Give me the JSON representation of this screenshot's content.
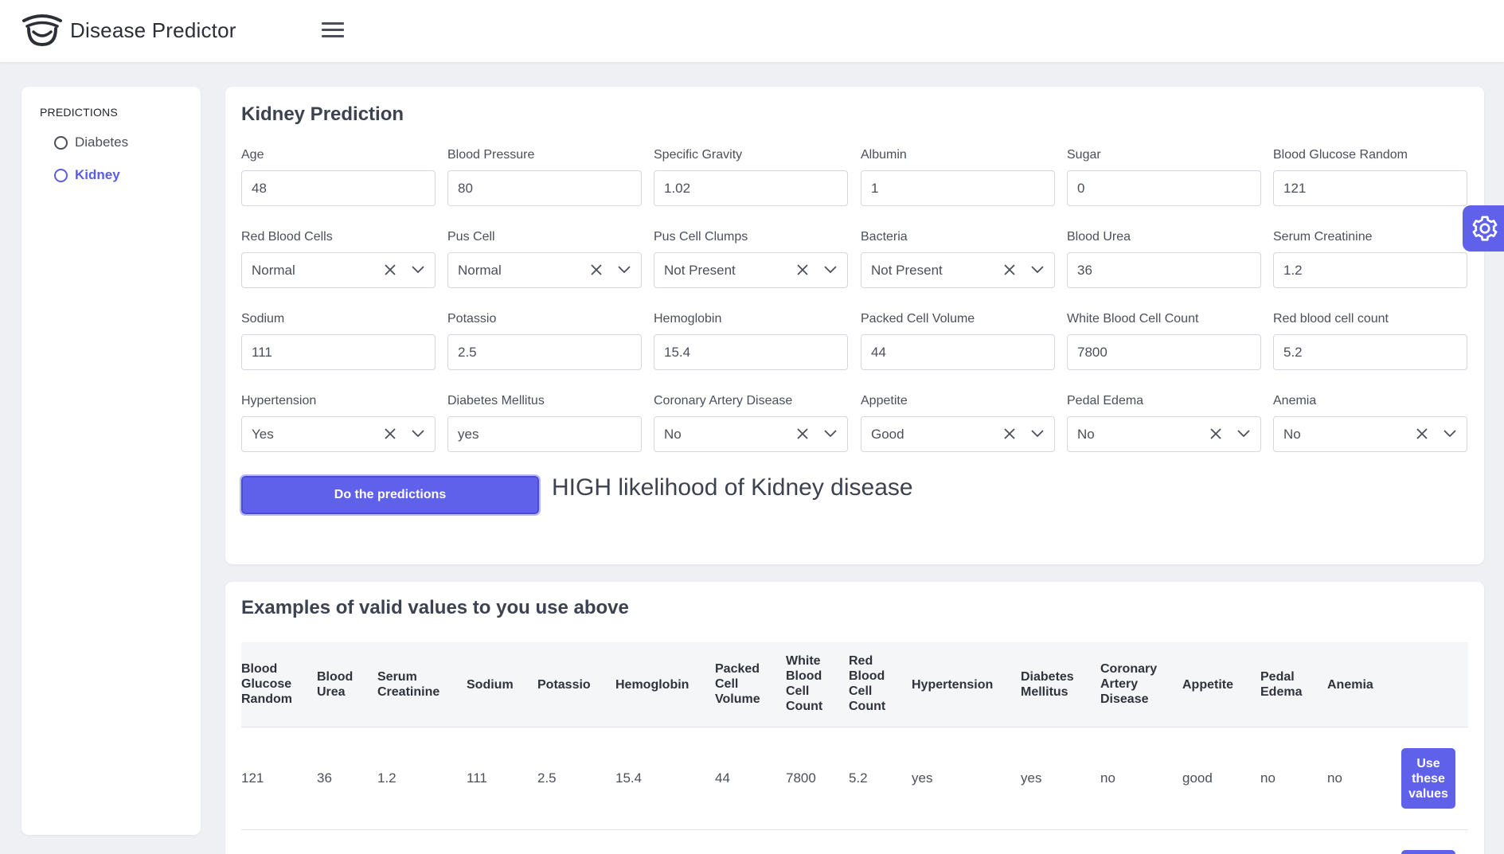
{
  "app": {
    "name": "Disease Predictor"
  },
  "sidebar": {
    "section_title": "PREDICTIONS",
    "items": [
      {
        "label": "Diabetes",
        "active": false
      },
      {
        "label": "Kidney",
        "active": true
      }
    ]
  },
  "form": {
    "title": "Kidney Prediction",
    "fields": {
      "age": {
        "label": "Age",
        "value": "48"
      },
      "blood_pressure": {
        "label": "Blood Pressure",
        "value": "80"
      },
      "specific_gravity": {
        "label": "Specific Gravity",
        "value": "1.02"
      },
      "albumin": {
        "label": "Albumin",
        "value": "1"
      },
      "sugar": {
        "label": "Sugar",
        "value": "0"
      },
      "blood_glucose_random": {
        "label": "Blood Glucose Random",
        "value": "121"
      },
      "red_blood_cells": {
        "label": "Red Blood Cells",
        "value": "Normal"
      },
      "pus_cell": {
        "label": "Pus Cell",
        "value": "Normal"
      },
      "pus_cell_clumps": {
        "label": "Pus Cell Clumps",
        "value": "Not Present"
      },
      "bacteria": {
        "label": "Bacteria",
        "value": "Not Present"
      },
      "blood_urea": {
        "label": "Blood Urea",
        "value": "36"
      },
      "serum_creatinine": {
        "label": "Serum Creatinine",
        "value": "1.2"
      },
      "sodium": {
        "label": "Sodium",
        "value": "111"
      },
      "potassio": {
        "label": "Potassio",
        "value": "2.5"
      },
      "hemoglobin": {
        "label": "Hemoglobin",
        "value": "15.4"
      },
      "packed_cell_volume": {
        "label": "Packed Cell Volume",
        "value": "44"
      },
      "white_blood_cell_count": {
        "label": "White Blood Cell Count",
        "value": "7800"
      },
      "red_blood_cell_count": {
        "label": "Red blood cell count",
        "value": "5.2"
      },
      "hypertension": {
        "label": "Hypertension",
        "value": "Yes"
      },
      "diabetes_mellitus": {
        "label": "Diabetes Mellitus",
        "value": "yes"
      },
      "coronary_artery_disease": {
        "label": "Coronary Artery Disease",
        "value": "No"
      },
      "appetite": {
        "label": "Appetite",
        "value": "Good"
      },
      "pedal_edema": {
        "label": "Pedal Edema",
        "value": "No"
      },
      "anemia": {
        "label": "Anemia",
        "value": "No"
      }
    },
    "predict_button": "Do the predictions",
    "result": "HIGH likelihood of Kidney disease"
  },
  "examples": {
    "title": "Examples of valid values to you use above",
    "headers": [
      "Blood\nGlucose\nRandom",
      "Blood\nUrea",
      "Serum\nCreatinine",
      "Sodium",
      "Potassio",
      "Hemoglobin",
      "Packed\nCell\nVolume",
      "White\nBlood\nCell\nCount",
      "Red\nBlood\nCell\nCount",
      "Hypertension",
      "Diabetes\nMellitus",
      "Coronary\nArtery\nDisease",
      "Appetite",
      "Pedal\nEdema",
      "Anemia"
    ],
    "rows": [
      [
        "121",
        "36",
        "1.2",
        "111",
        "2.5",
        "15.4",
        "44",
        "7800",
        "5.2",
        "yes",
        "yes",
        "no",
        "good",
        "no",
        "no"
      ]
    ],
    "use_button": "Use\nthese\nvalues"
  },
  "colors": {
    "accent": "#6061ea",
    "background": "#eef0f4"
  },
  "icons": {
    "settings": "gear-icon",
    "menu": "hamburger-icon"
  }
}
